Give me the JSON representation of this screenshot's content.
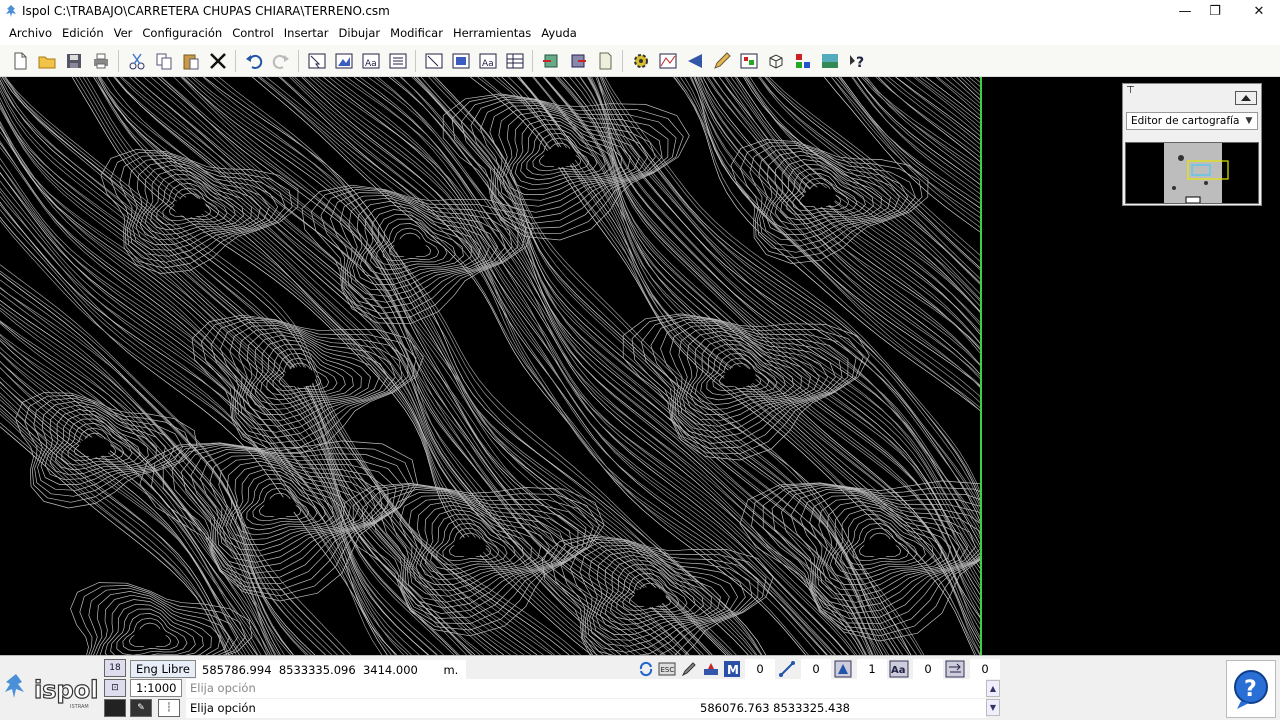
{
  "window": {
    "title": "Ispol  C:\\TRABAJO\\CARRETERA CHUPAS CHIARA\\TERRENO.csm",
    "controls": {
      "minimize": "—",
      "maximize": "❐",
      "close": "✕"
    }
  },
  "menu": {
    "items": [
      "Archivo",
      "Edición",
      "Ver",
      "Configuración",
      "Control",
      "Insertar",
      "Dibujar",
      "Modificar",
      "Herramientas",
      "Ayuda"
    ]
  },
  "toolbar": {
    "icons": [
      "new-file-icon",
      "open-folder-icon",
      "save-icon",
      "print-icon",
      "cut-icon",
      "copy-icon",
      "paste-icon",
      "delete-icon",
      "undo-icon",
      "redo-icon",
      "layer-select-icon",
      "terrain-view-icon",
      "text-view-icon",
      "list-view-icon",
      "view-frame-icon",
      "plan-view-icon",
      "text-style-icon",
      "table-view-icon",
      "import-icon",
      "export-icon",
      "document-icon",
      "settings-gear-icon",
      "profile-chart-icon",
      "direction-arrow-icon",
      "pencil-icon",
      "image-icon",
      "3d-box-icon",
      "color-blocks-icon",
      "landscape-icon",
      "help-icon"
    ]
  },
  "cartography_panel": {
    "select_value": "Editor de cartografía"
  },
  "statusbar": {
    "layer_badge": "18",
    "mode": "Eng Libre",
    "scale": "1:1000",
    "coord_x": "585786.994",
    "coord_y": "8533335.096",
    "coord_z": "3414.000",
    "unit": "m.",
    "prompt1": "Elija opción",
    "prompt2": "Elija opción",
    "cursor_coords": "586076.763  8533325.438",
    "counters": [
      "0",
      "0",
      "1",
      "0",
      "0"
    ],
    "brand": "ispol",
    "brand_sub": "ISTRAM"
  }
}
